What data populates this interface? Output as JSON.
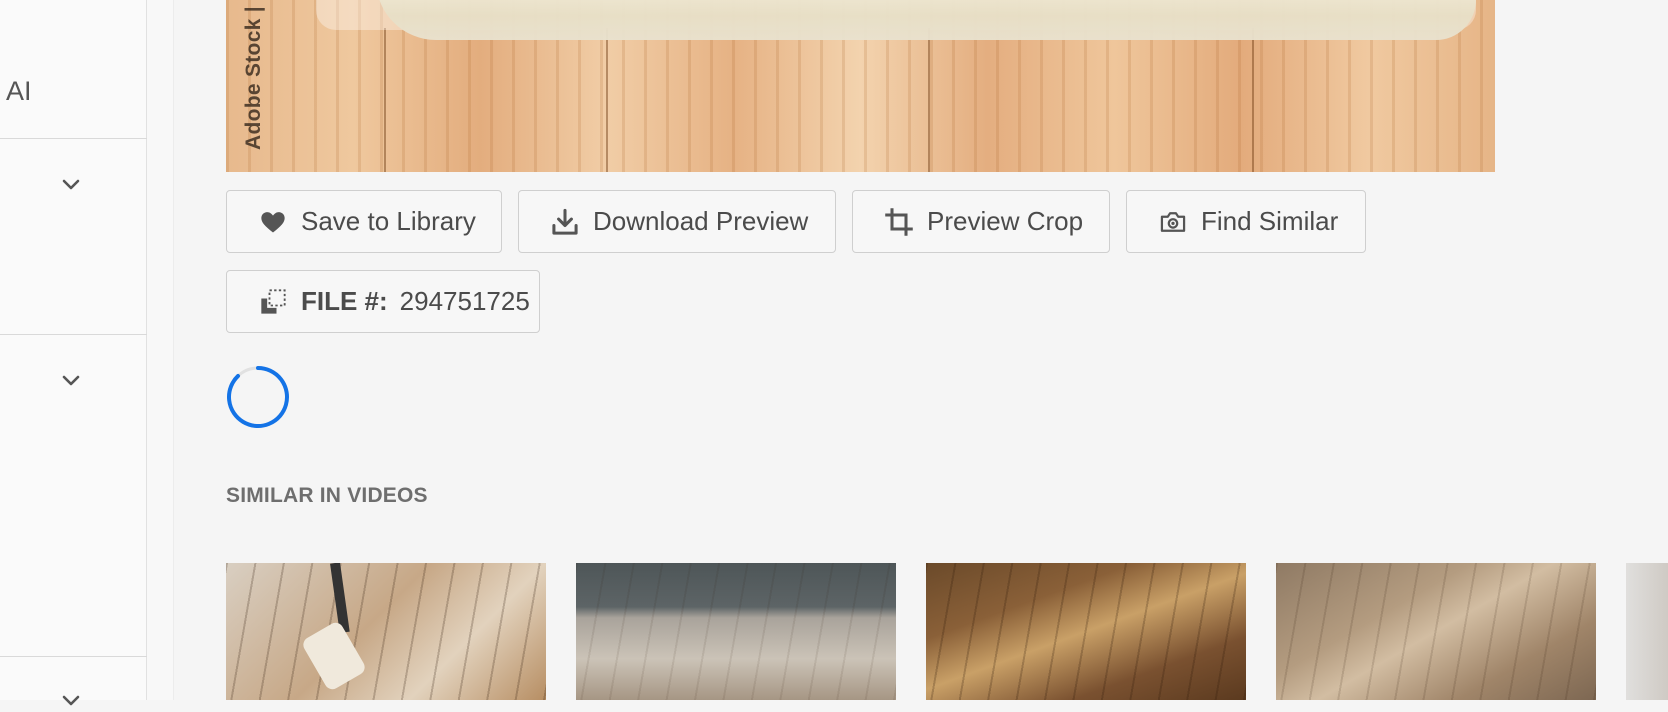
{
  "sidebar": {
    "label_ai": "AI"
  },
  "hero": {
    "watermark": "Adobe Stock |"
  },
  "actions": {
    "save_to_library": "Save to Library",
    "download_preview": "Download Preview",
    "preview_crop": "Preview Crop",
    "find_similar": "Find Similar"
  },
  "file": {
    "label": "FILE #:",
    "number": "294751725"
  },
  "similar": {
    "title": "SIMILAR IN VIDEOS"
  },
  "icons": {
    "save": "heart-icon",
    "download": "download-icon",
    "crop": "crop-icon",
    "find": "camera-icon",
    "file": "copy-icon",
    "expand": "chevron-down-icon"
  },
  "colors": {
    "spinner": "#1473e6",
    "background": "#f5f5f5",
    "button_border": "#cfcfcf"
  }
}
